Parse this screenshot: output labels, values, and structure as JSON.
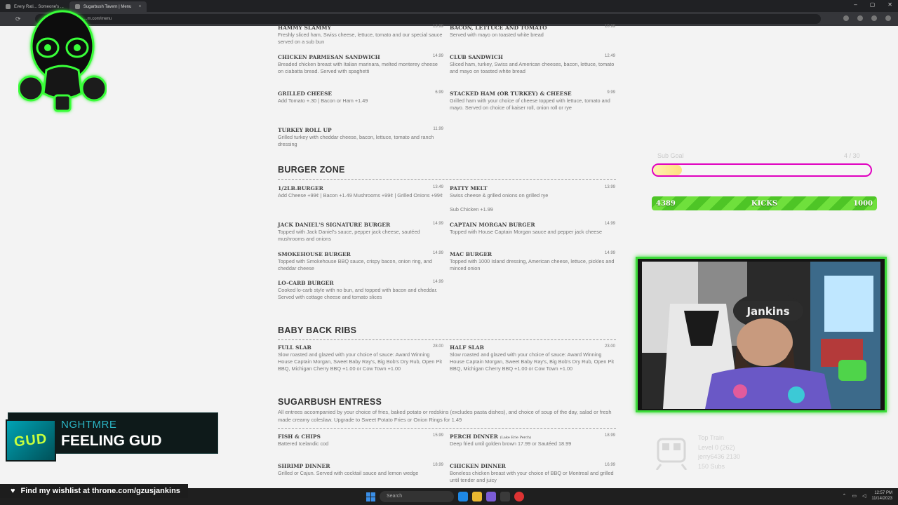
{
  "browser": {
    "tabs": [
      {
        "label": "Every Rati... Someone's ..."
      },
      {
        "label": "Sugarbush Tavern | Menu"
      }
    ],
    "url": "...m.com/menu",
    "window_controls": [
      "–",
      "▢",
      "✕"
    ]
  },
  "menu": {
    "items_top": [
      {
        "name": "HAMMY SLAMMY",
        "price": "13.99",
        "desc": "Freshly sliced ham, Swiss cheese, lettuce, tomato and our special sauce served on a sub bun"
      },
      {
        "name": "BACON, LETTUCE AND TOMATO",
        "price": "10.99",
        "desc": "Served with mayo on toasted white bread"
      },
      {
        "name": "CHICKEN PARMESAN SANDWICH",
        "price": "14.99",
        "desc": "Breaded chicken breast with Italian marinara, melted monterey cheese on ciabatta bread. Served with spaghetti"
      },
      {
        "name": "CLUB SANDWICH",
        "price": "12.49",
        "desc": "Sliced ham, turkey, Swiss and American cheeses, bacon, lettuce, tomato and mayo on toasted white bread"
      },
      {
        "name": "GRILLED CHEESE",
        "price": "6.99",
        "desc": "Add Tomato +.30 | Bacon or Ham +1.49"
      },
      {
        "name": "STACKED HAM (OR TURKEY) & CHEESE",
        "price": "9.99",
        "desc": "Grilled ham with your choice of cheese topped with lettuce, tomato and mayo. Served on choice of kaiser roll, onion roll or rye"
      },
      {
        "name": "TURKEY ROLL UP",
        "price": "11.99",
        "desc": "Grilled turkey with cheddar cheese, bacon, lettuce, tomato and ranch dressing"
      }
    ],
    "burger_section": "BURGER ZONE",
    "burgers": [
      {
        "name": "1/2LB.BURGER",
        "price": "13.49",
        "desc": "Add Cheese +99¢ | Bacon +1.49 Mushrooms +99¢ | Grilled Onions +99¢"
      },
      {
        "name": "PATTY MELT",
        "price": "13.99",
        "desc": "Swiss cheese & grilled onions on grilled rye"
      },
      {
        "name": "",
        "price": "",
        "desc": "Sub Chicken +1.99"
      },
      {
        "name": "JACK DANIEL'S SIGNATURE BURGER",
        "price": "14.99",
        "desc": "Topped with Jack Daniel's sauce, pepper jack cheese, sautéed mushrooms and onions"
      },
      {
        "name": "CAPTAIN MORGAN BURGER",
        "price": "14.99",
        "desc": "Topped with House Captain Morgan sauce and pepper jack cheese"
      },
      {
        "name": "SMOKEHOUSE BURGER",
        "price": "14.99",
        "desc": "Topped with Smokehouse BBQ sauce, crispy bacon, onion ring, and cheddar cheese"
      },
      {
        "name": "MAC BURGER",
        "price": "14.99",
        "desc": "Topped with 1000 Island dressing, American cheese, lettuce, pickles and minced onion"
      },
      {
        "name": "LO-CARB BURGER",
        "price": "14.99",
        "desc": "Cooked lo-carb style with no bun, and topped with bacon and cheddar. Served with cottage cheese and tomato slices"
      }
    ],
    "ribs_section": "BABY BACK RIBS",
    "ribs": [
      {
        "name": "FULL SLAB",
        "price": "28.00",
        "desc": "Slow roasted and glazed with your choice of sauce: Award Winning House Captain Morgan, Sweet Baby Ray's, Big Bob's Dry Rub, Open Pit BBQ, Michigan Cherry BBQ +1.00 or Cow Town +1.00"
      },
      {
        "name": "HALF SLAB",
        "price": "23.00",
        "desc": "Slow roasted and glazed with your choice of sauce: Award Winning House Captain Morgan, Sweet Baby Ray's, Big Bob's Dry Rub, Open Pit BBQ, Michigan Cherry BBQ +1.00 or Cow Town +1.00"
      }
    ],
    "entrees_section": "SUGARBUSH ENTRESS",
    "entrees_note": "All entrees accompanied by your choice of fries, baked potato or redskins (excludes pasta dishes), and choice of soup of the day, salad or fresh made creamy coleslaw. Upgrade to Sweet Potato Fries or Onion Rings for 1.49",
    "entrees": [
      {
        "name": "FISH & CHIPS",
        "price": "15.99",
        "desc": "Battered Icelandic cod"
      },
      {
        "name": "PERCH DINNER",
        "tag": "(Lake Erie Perch)",
        "price": "18.99",
        "desc": "Deep fried until golden brown 17.99 or Sautéed 18.99"
      },
      {
        "name": "SHRIMP DINNER",
        "price": "18.99",
        "desc": "Grilled or Cajun. Served with cocktail sauce and lemon wedge"
      },
      {
        "name": "CHICKEN DINNER",
        "price": "16.99",
        "desc": "Boneless chicken breast with your choice of BBQ or Montreal and grilled until tender and juicy"
      }
    ]
  },
  "overlay": {
    "sub_goal_label": "Sub Goal",
    "sub_goal_count": "4 / 30",
    "sub_goal_progress": 0.133,
    "kicks_current": "4389",
    "kicks_label": "KICKS",
    "kicks_target": "1000",
    "train": {
      "title": "Top Train",
      "level": "Level 0 (262)",
      "user": "jerry6436 2130",
      "subs": "150 Subs"
    },
    "now_playing": {
      "artist": "NGHTMRE",
      "title": "FEELING GUD",
      "art_text": "GUD"
    },
    "wishlist": "Find my wishlist at throne.com/gzusjankins",
    "cam_hat_text": "Jankins"
  },
  "taskbar": {
    "search_placeholder": "Search",
    "time": "12:57 PM",
    "date": "11/14/2023"
  },
  "colors": {
    "subgoal_border": "#e000c0",
    "kicks_green": "#4ec526",
    "cam_border": "#3ddc3a",
    "np_teal": "#2bb6c5"
  }
}
